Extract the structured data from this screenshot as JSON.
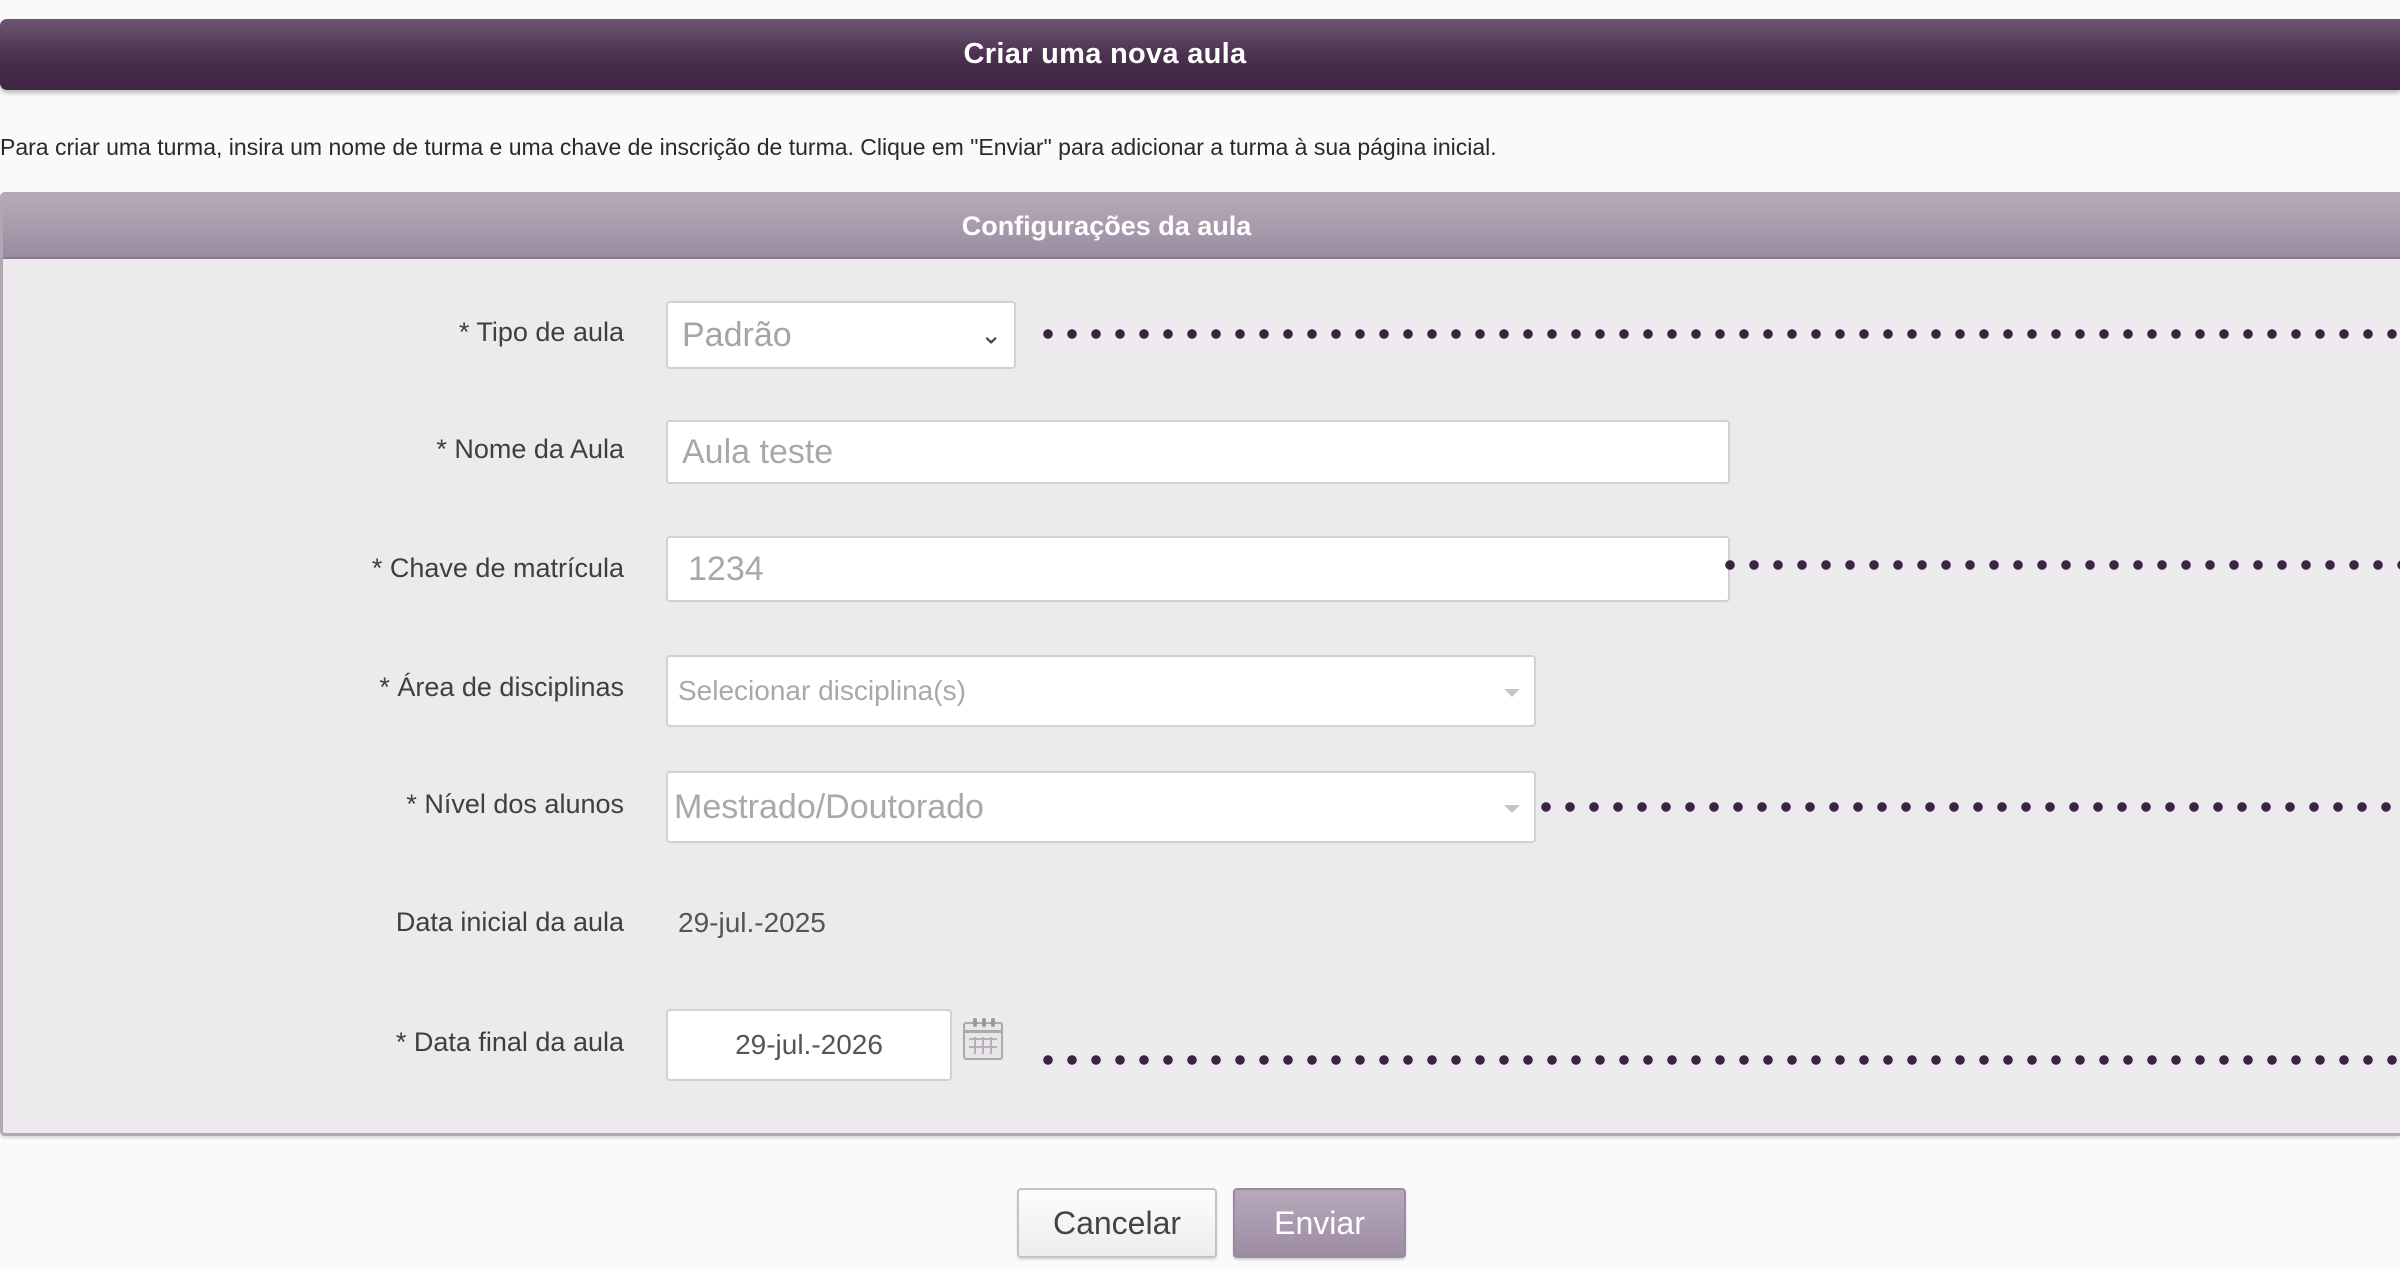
{
  "header": {
    "title": "Criar uma nova aula"
  },
  "intro_text": "Para criar uma turma, insira um nome de turma e uma chave de inscrição de turma. Clique em \"Enviar\" para adicionar a turma à sua página inicial.",
  "panel": {
    "title": "Configurações da aula"
  },
  "form": {
    "class_type": {
      "label": "* Tipo de aula",
      "value": "Padrão"
    },
    "class_name": {
      "label": "* Nome da Aula",
      "value": "Aula teste"
    },
    "enrollment_key": {
      "label": "* Chave de matrícula",
      "value": "1234"
    },
    "subject_area": {
      "label": "*  Área de disciplinas",
      "placeholder": "Selecionar disciplina(s)"
    },
    "student_level": {
      "label": "*  Nível dos alunos",
      "value": "Mestrado/Doutorado"
    },
    "start_date": {
      "label": "Data inicial da aula",
      "value": "29-jul.-2025"
    },
    "end_date": {
      "label": "* Data final da aula",
      "value": "29-jul.-2026"
    }
  },
  "buttons": {
    "cancel": "Cancelar",
    "submit": "Enviar"
  },
  "icons": {
    "select_arrow": "chevron-down-icon",
    "date_picker": "calendar-icon"
  },
  "colors": {
    "header_bg": "#4a2f4e",
    "panel_header_bg": "#a898ac",
    "panel_bg": "#eceaed",
    "submit_bg": "#a696aa",
    "annotation_dots": "#3b2341"
  }
}
